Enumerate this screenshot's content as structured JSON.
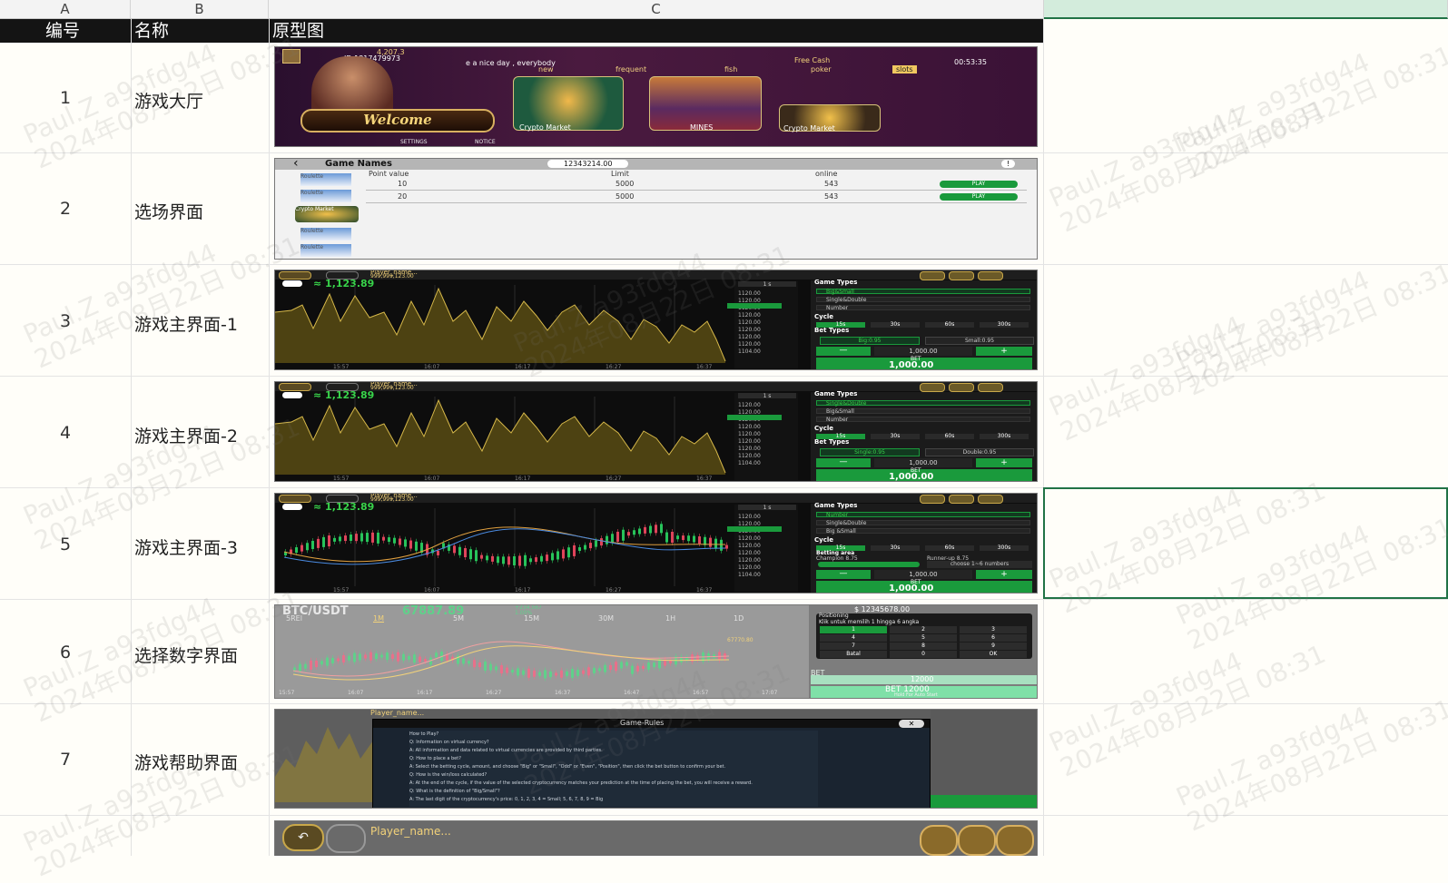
{
  "sheet": {
    "columns": [
      "A",
      "B",
      "C"
    ],
    "headers": {
      "id": "编号",
      "name": "名称",
      "prototype": "原型图"
    },
    "watermark": {
      "line1": "Paul.Z  a93fdg44",
      "line2": "2024年08月22日 08:31"
    },
    "rows": [
      {
        "num": "1",
        "name": "游戏大厅"
      },
      {
        "num": "2",
        "name": "选场界面"
      },
      {
        "num": "3",
        "name": "游戏主界面-1"
      },
      {
        "num": "4",
        "name": "游戏主界面-2"
      },
      {
        "num": "5",
        "name": "游戏主界面-3"
      },
      {
        "num": "6",
        "name": "选择数字界面"
      },
      {
        "num": "7",
        "name": "游戏帮助界面"
      }
    ]
  },
  "lobby": {
    "balance": "4,207.3",
    "user_id": "ID 1817479973",
    "marquee": "e a nice day , everybody",
    "tabs": [
      "new",
      "frequent",
      "fish",
      "poker",
      "slots"
    ],
    "welcome": "Welcome",
    "games": [
      "Crypto Market",
      "MINES",
      "Crypto Market"
    ],
    "bottom": [
      "SETTINGS",
      "NOTICE"
    ],
    "cash_label": "Free Cash",
    "timer": "00:53:35"
  },
  "select": {
    "title": "Game Names",
    "balance": "12343214.00",
    "columns": [
      "Point value",
      "Limit",
      "online"
    ],
    "rows": [
      {
        "point": "10",
        "limit": "5000",
        "online": "543",
        "action": "PLAY"
      },
      {
        "point": "20",
        "limit": "5000",
        "online": "543",
        "action": "PLAY"
      }
    ],
    "side": [
      "Roulette",
      "Roulette",
      "Crypto Market",
      "Roulette",
      "Roulette"
    ]
  },
  "main": {
    "player": "Player_name...",
    "balance": "999,999,123.00",
    "price": "≈ 1,123.89",
    "interval": "1 s",
    "axis_prices": [
      "1120.00",
      "1120.00",
      "1120.00",
      "1120.00",
      "1120.00",
      "1120.00",
      "1120.00",
      "1120.00",
      "1104.00"
    ],
    "times": [
      "15:57",
      "16:07",
      "16:17",
      "16:27",
      "16:37"
    ],
    "game_types_label": "Game Types",
    "cycle_label": "Cycle",
    "cycles": [
      "15s",
      "30s",
      "60s",
      "300s"
    ],
    "bet_types_label": "Bet Types",
    "bet_amount": "1,000.00",
    "bet_label": "BET",
    "bet_total": "1,000.00",
    "v1": {
      "types": [
        "Big&Small",
        "Single&Double",
        "Number"
      ],
      "bets": [
        "Big:0.95",
        "Small:0.95"
      ]
    },
    "v2": {
      "types": [
        "Single&Double",
        "Big&Small",
        "Number"
      ],
      "bets": [
        "Single:0.95",
        "Double:0.95"
      ]
    },
    "v3": {
      "types": [
        "Number",
        "Single&Double",
        "Big &Small"
      ],
      "area_label": "Betting area",
      "champion": "Champion 8.75",
      "runner": "Runner-up 8.75",
      "choose": "choose 1~6 numbers"
    }
  },
  "numpad": {
    "pair": "BTC/USDT",
    "price": "67887.89",
    "change": "+234.567",
    "pct": "1.00%",
    "intervals": [
      "5REl",
      "1M",
      "5M",
      "15M",
      "30M",
      "1H",
      "1D"
    ],
    "marker": "67770.80",
    "balance": "$ 12345678.00",
    "positioning": "Positioning",
    "hint": "Klik untuk memilih 1 hingga 6 angka",
    "keys": [
      "1",
      "2",
      "3",
      "4",
      "5",
      "6",
      "7",
      "8",
      "9",
      "Batal",
      "0",
      "OK"
    ],
    "bet_label": "BET",
    "amount": "12000",
    "bet_button": "BET 12000",
    "hold": "Hold For Auto Start",
    "times": [
      "15:57",
      "16:07",
      "16:17",
      "16:27",
      "16:37",
      "16:47",
      "16:57",
      "17:07"
    ]
  },
  "help": {
    "title": "Game-Rules",
    "lines": [
      "How to Play?",
      "Q: Information on virtual currency?",
      "A: All information and data related to virtual currencies are provided by third parties.",
      "Q: How to place a bet?",
      "A: Select the betting cycle, amount, and choose \"Big\" or \"Small\", \"Odd\" or \"Even\", \"Position\", then click the bet button to confirm your bet.",
      "Q: How is the win/loss calculated?",
      "A: At the end of the cycle, if the value of the selected cryptocurrency matches your prediction at the time of placing the bet, you will receive a reward.",
      "Q: What is the definition of \"Big/Small\"?",
      "A: The last digit of the cryptocurrency's price: 0, 1, 2, 3, 4 = Small; 5, 6, 7, 8, 9 = Big"
    ]
  },
  "row8": {
    "player": "Player_name..."
  }
}
